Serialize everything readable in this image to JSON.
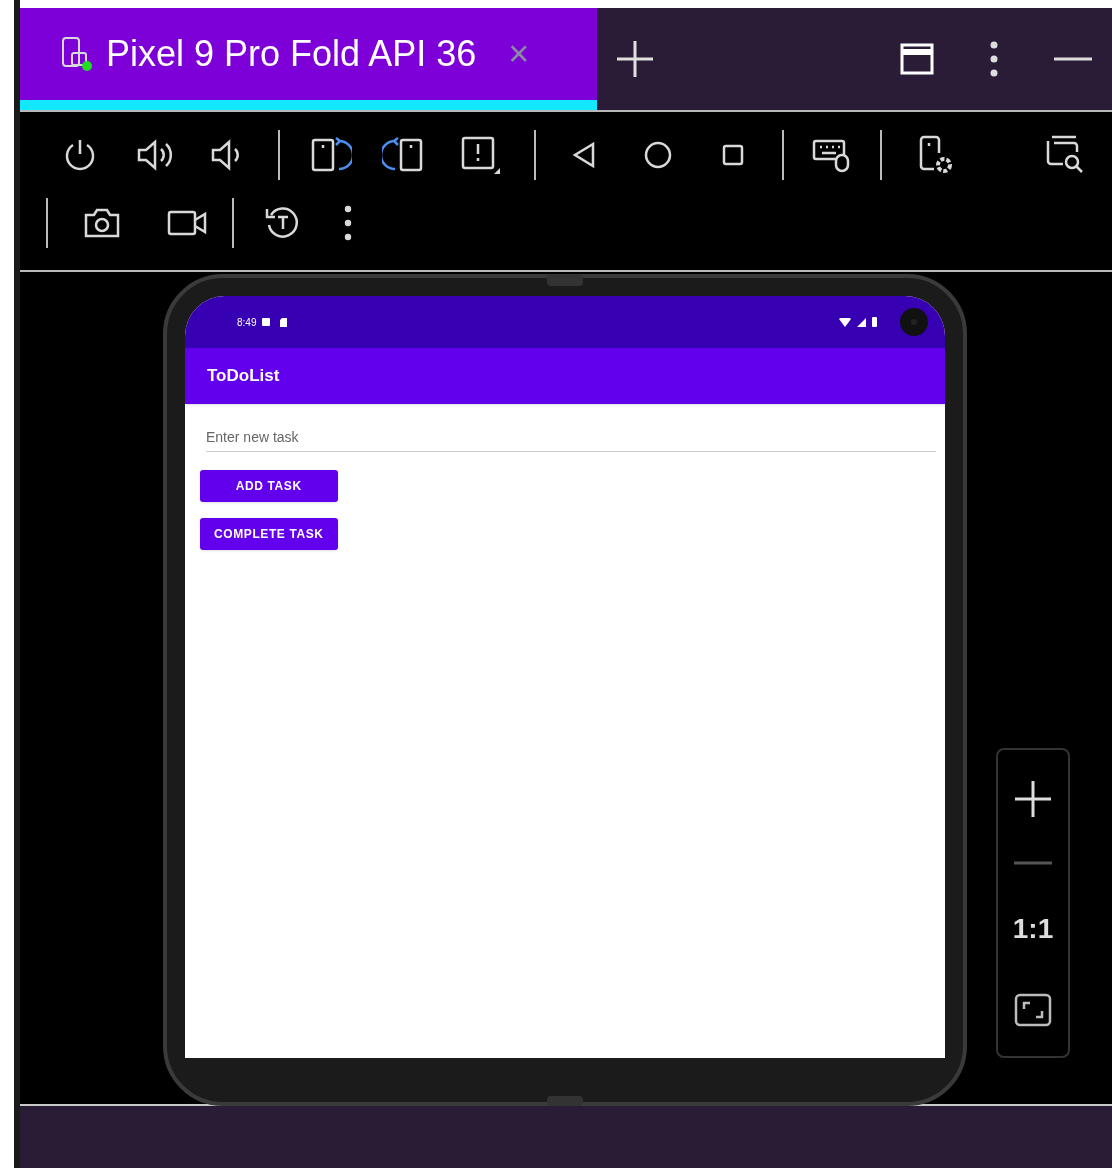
{
  "tab": {
    "title": "Pixel 9 Pro Fold API 36",
    "selected": true,
    "close": "×"
  },
  "device": {
    "status_bar": {
      "time": "8:49"
    },
    "app_bar": {
      "title": "ToDoList"
    },
    "task_field": {
      "placeholder": "Enter new task"
    },
    "buttons": [
      "ADD TASK",
      "COMPLETE TASK"
    ]
  },
  "zoom_controls": {
    "actual_size": "1:1"
  }
}
